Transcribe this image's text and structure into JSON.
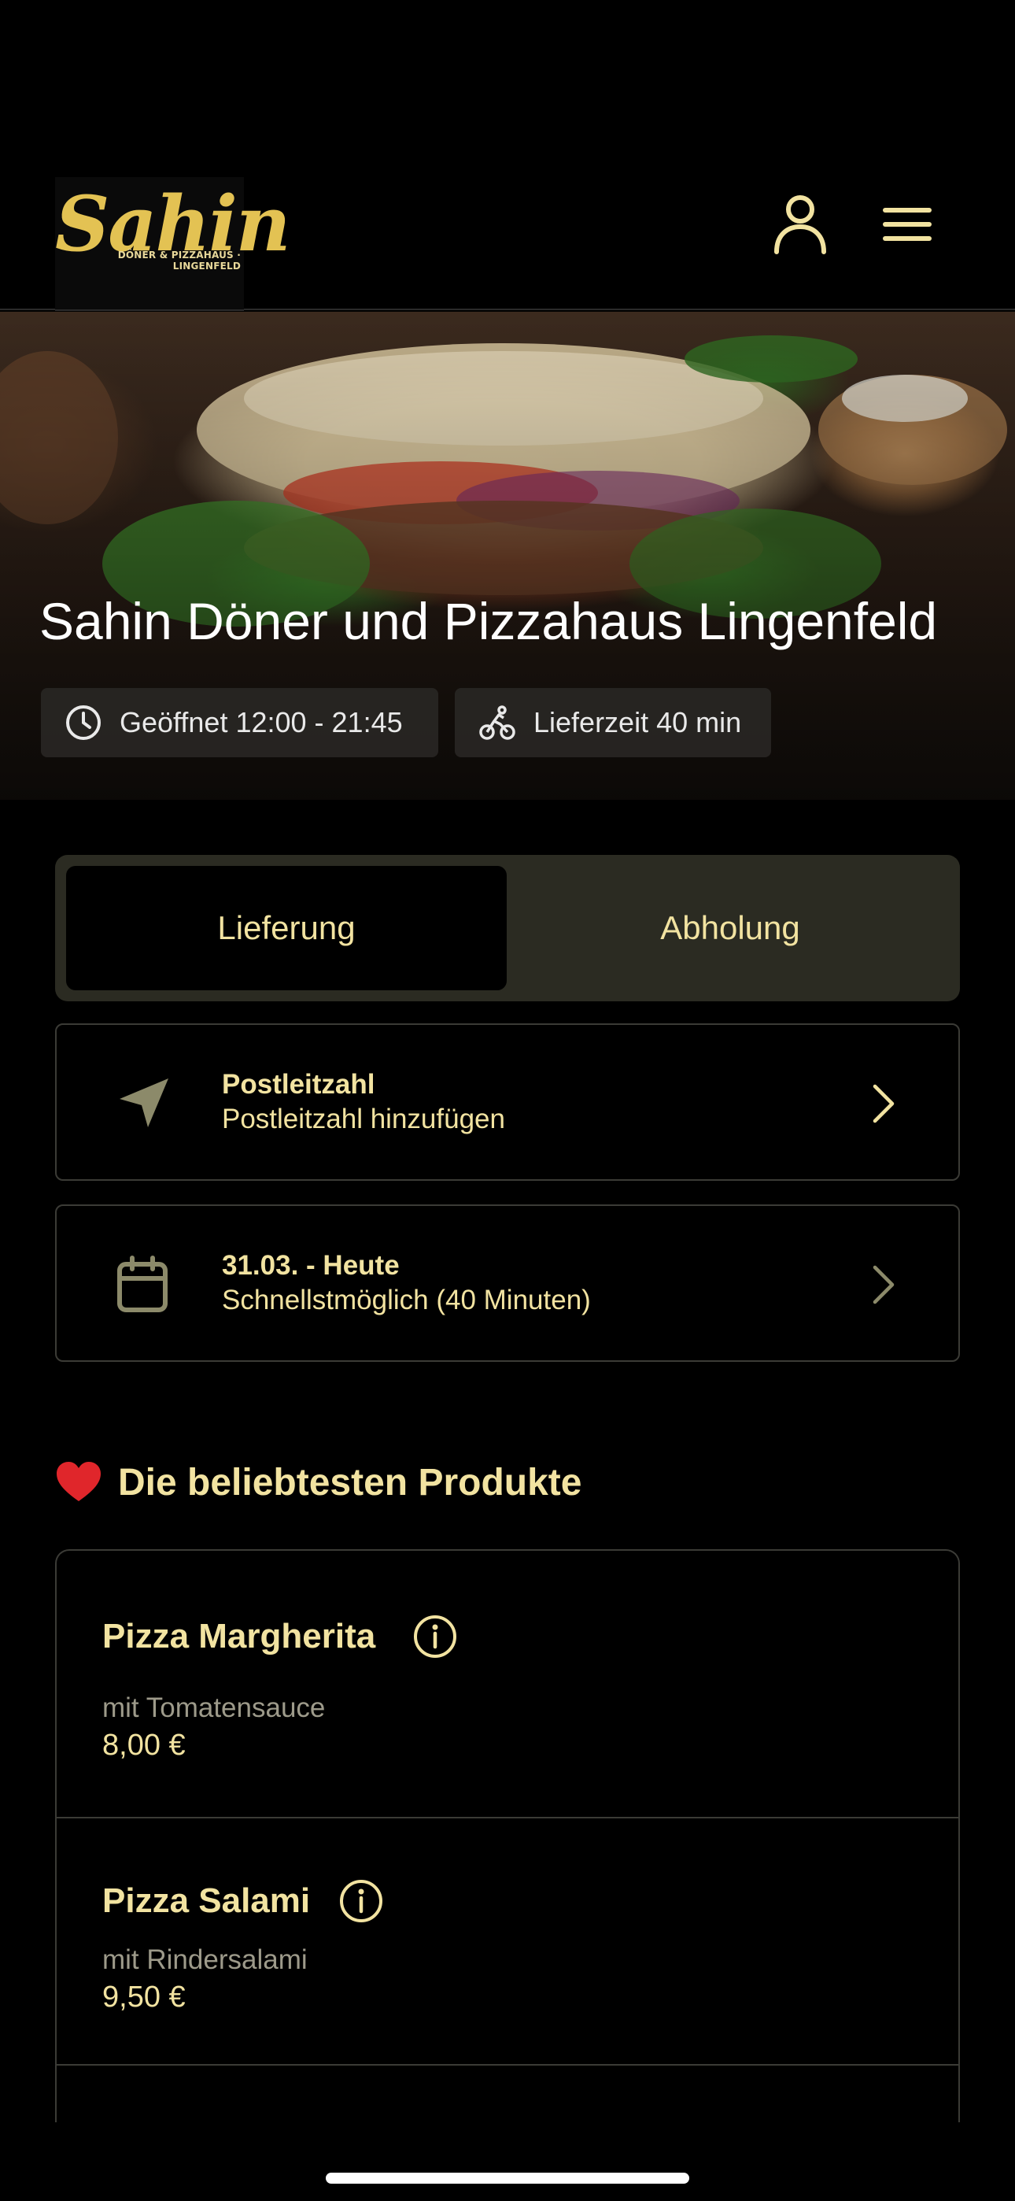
{
  "header": {
    "logo_text": "Sahin",
    "logo_subtitle": "DÖNER & PIZZAHAUS · LINGENFELD",
    "user_icon": "user-icon",
    "menu_icon": "hamburger-menu-icon"
  },
  "hero": {
    "title": "Sahin Döner und Pizzahaus Lingenfeld",
    "opening": {
      "icon": "clock-icon",
      "text": "Geöffnet 12:00 - 21:45"
    },
    "delivery": {
      "icon": "bike-icon",
      "text": "Lieferzeit 40 min"
    }
  },
  "order_mode": {
    "options": [
      "Lieferung",
      "Abholung"
    ],
    "selected": "Lieferung"
  },
  "postcode": {
    "icon": "location-arrow-icon",
    "title": "Postleitzahl",
    "subtitle": "Postleitzahl hinzufügen"
  },
  "schedule": {
    "icon": "calendar-icon",
    "title": "31.03. - Heute",
    "subtitle": "Schnellstmöglich (40 Minuten)"
  },
  "popular": {
    "heading": "Die beliebtesten Produkte",
    "heading_icon": "heart-icon",
    "products": [
      {
        "name": "Pizza Margherita",
        "description": "mit Tomatensauce",
        "price": "8,00 €"
      },
      {
        "name": "Pizza Salami",
        "description": "mit Rindersalami",
        "price": "9,50 €"
      }
    ]
  },
  "colors": {
    "accent": "#f2e3a1",
    "gold": "#e3c253",
    "background": "#000000",
    "toggle_bg": "#2b2b22",
    "heart": "#e0262b",
    "muted": "#9d9a8a"
  }
}
